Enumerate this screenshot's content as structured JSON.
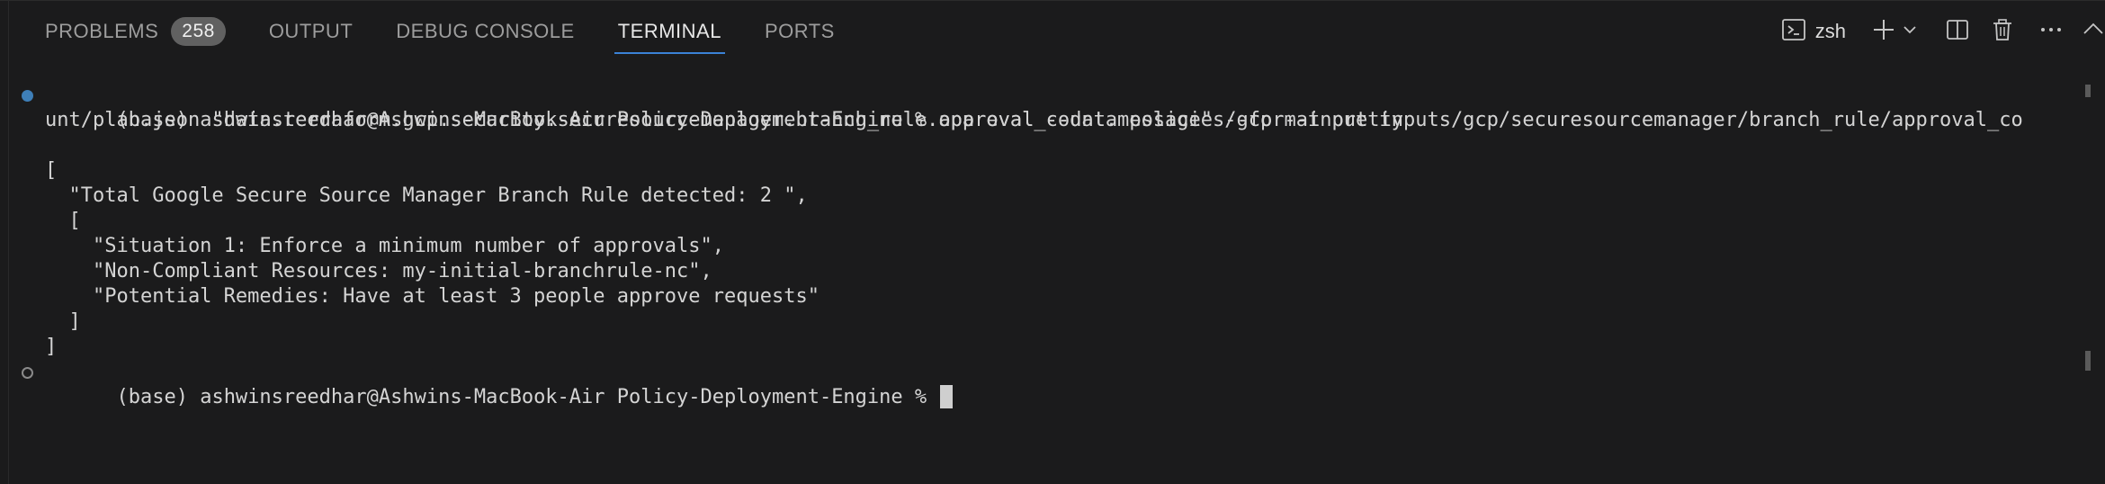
{
  "tabs": [
    {
      "label": "PROBLEMS",
      "badge": "258"
    },
    {
      "label": "OUTPUT"
    },
    {
      "label": "DEBUG CONSOLE"
    },
    {
      "label": "TERMINAL",
      "active": true
    },
    {
      "label": "PORTS"
    }
  ],
  "actions": {
    "shell_name": "zsh",
    "icons": [
      "terminal-icon",
      "plus-icon",
      "chevron-down-icon",
      "split-icon",
      "trash-icon",
      "more-icon",
      "chevron-up-icon"
    ]
  },
  "terminal": {
    "lines": [
      "(base) ashwinsreedhar@Ashwins-MacBook-Air Policy-Deployment-Engine % opa eval --data policies/gcp --input inputs/gcp/securesourcemanager/branch_rule/approval_co",
      "unt/plan.json \"data.terraform.gcp.security.securesourcemanager.branch_rule.approval_count.message\" --format pretty",
      "",
      "[",
      "  \"Total Google Secure Source Manager Branch Rule detected: 2 \",",
      "  [",
      "    \"Situation 1: Enforce a minimum number of approvals\",",
      "    \"Non-Compliant Resources: my-initial-branchrule-nc\",",
      "    \"Potential Remedies: Have at least 3 people approve requests\"",
      "  ]",
      "]",
      "(base) ashwinsreedhar@Ashwins-MacBook-Air Policy-Deployment-Engine % "
    ]
  },
  "colors": {
    "background": "#1b1b1c",
    "active_tab_underline": "#3b82d6",
    "command_marker": "#3e7fb8"
  }
}
